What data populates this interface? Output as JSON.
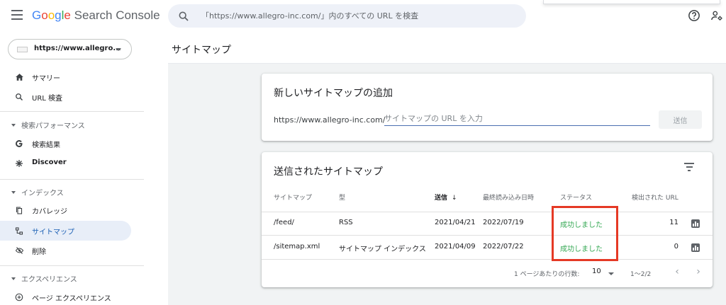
{
  "header": {
    "logo_letters": [
      "G",
      "o",
      "o",
      "g",
      "l",
      "e"
    ],
    "logo_rest": " Search Console",
    "search_placeholder": "「https://www.allegro-inc.com/」内のすべての URL を検査"
  },
  "sidebar": {
    "property_label": "https://www.allegro...",
    "items": [
      {
        "label": "サマリー",
        "icon": "home-icon"
      },
      {
        "label": "URL 検査",
        "icon": "search-icon"
      }
    ],
    "sections": [
      {
        "label": "検索パフォーマンス",
        "items": [
          {
            "label": "検索結果",
            "icon": "google-g-icon"
          },
          {
            "label": "Discover",
            "icon": "asterisk-icon"
          }
        ]
      },
      {
        "label": "インデックス",
        "items": [
          {
            "label": "カバレッジ",
            "icon": "copy-icon"
          },
          {
            "label": "サイトマップ",
            "icon": "sitemap-icon",
            "active": true
          },
          {
            "label": "削除",
            "icon": "eye-off-icon"
          }
        ]
      },
      {
        "label": "エクスペリエンス",
        "items": [
          {
            "label": "ページ エクスペリエンス",
            "icon": "plus-circle-icon"
          }
        ]
      }
    ]
  },
  "main": {
    "page_title": "サイトマップ",
    "add_card": {
      "title": "新しいサイトマップの追加",
      "url_prefix": "https://www.allegro-inc.com/",
      "input_placeholder": "サイトマップの URL を入力",
      "submit_label": "送信"
    },
    "submitted_card": {
      "title": "送信されたサイトマップ",
      "columns": {
        "sitemap": "サイトマップ",
        "type": "型",
        "submitted": "送信",
        "last_read": "最終読み込み日時",
        "status": "ステータス",
        "urls": "検出された URL"
      },
      "sort_arrow": "↓",
      "rows": [
        {
          "sitemap": "/feed/",
          "type": "RSS",
          "submitted": "2021/04/21",
          "last_read": "2022/07/19",
          "status": "成功しました",
          "urls": "11"
        },
        {
          "sitemap": "/sitemap.xml",
          "type": "サイトマップ インデックス",
          "submitted": "2021/04/09",
          "last_read": "2022/07/22",
          "status": "成功しました",
          "urls": "0"
        }
      ],
      "footer": {
        "rows_per_page_label": "1 ページあたりの行数:",
        "rows_per_page": "10",
        "range": "1〜2/2",
        "prev_icon": "‹",
        "next_icon": "›"
      }
    }
  },
  "colors": {
    "accent": "#1a73e8",
    "status_success": "#34a853",
    "highlight": "#e53925"
  }
}
